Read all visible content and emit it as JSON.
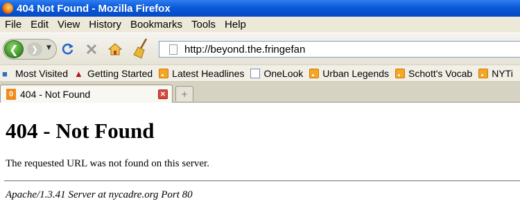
{
  "window": {
    "title": "404 Not Found - Mozilla Firefox"
  },
  "menu": [
    {
      "label": "File"
    },
    {
      "label": "Edit"
    },
    {
      "label": "View"
    },
    {
      "label": "History"
    },
    {
      "label": "Bookmarks"
    },
    {
      "label": "Tools"
    },
    {
      "label": "Help"
    }
  ],
  "toolbar": {
    "icons": [
      "back-icon",
      "forward-icon",
      "reload-icon",
      "stop-icon",
      "home-icon",
      "clear-history-broom-icon"
    ],
    "url_prefix": "http://",
    "url_host": "beyond.the.fringefan"
  },
  "bookmarks": [
    {
      "label": "Most Visited",
      "icon": "star-icon"
    },
    {
      "label": "Getting Started",
      "icon": "redhat-icon"
    },
    {
      "label": "Latest Headlines",
      "icon": "rss-icon"
    },
    {
      "label": "OneLook",
      "icon": "page-icon"
    },
    {
      "label": "Urban Legends",
      "icon": "rss-icon"
    },
    {
      "label": "Schott's Vocab",
      "icon": "rss-icon"
    },
    {
      "label": "NYTi",
      "icon": "rss-icon"
    }
  ],
  "tabs": [
    {
      "label": "404 - Not Found",
      "favicon": "0"
    }
  ],
  "page": {
    "heading": "404 - Not Found",
    "message": "The requested URL was not found on this server.",
    "server_signature": "Apache/1.3.41 Server at nycadre.org Port 80"
  },
  "colors": {
    "titlebar": "#0a5ad9",
    "chrome": "#ece9d8",
    "tab_close": "#d9453a"
  }
}
